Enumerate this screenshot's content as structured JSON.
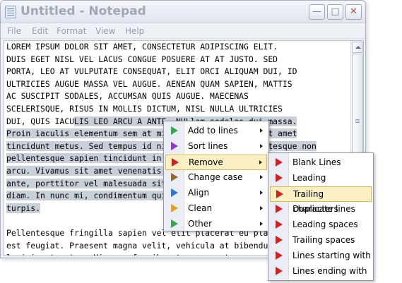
{
  "window": {
    "title": "Untitled - Notepad"
  },
  "menubar": [
    "File",
    "Edit",
    "Format",
    "View",
    "Help"
  ],
  "editor": {
    "lines": [
      {
        "pre": "LOREM IPSUM DOLOR SIT AMET, CONSECTETUR ADIPISCING ELIT.",
        "sel": "",
        "post": ""
      },
      {
        "pre": "DUIS EGET NISL VEL LACUS CONGUE POSUERE AT AT JUSTO. SED",
        "sel": "",
        "post": ""
      },
      {
        "pre": "PORTA, LEO AT VULPUTATE CONSEQUAT, ELIT ORCI ALIQUAM DUI, ID",
        "sel": "",
        "post": ""
      },
      {
        "pre": "ULTRICIES AUGUE MASSA VEL AUGUE. AENEAN QUAM SAPIEN, MATTIS",
        "sel": "",
        "post": ""
      },
      {
        "pre": "AC SUSCIPIT SODALES, ACCUMSAN QUIS AUGUE. MAECENAS",
        "sel": "",
        "post": ""
      },
      {
        "pre": "SCELERISQUE, RISUS IN MOLLIS DICTUM, NISL NULLA ULTRICIES",
        "sel": "",
        "post": ""
      },
      {
        "pre": "DUI, QUIS IACU",
        "sel": "LIS LEO ARCU A ANTE. NULlam sodales dui massa.",
        "post": ""
      },
      {
        "pre": "",
        "sel": "Proin iaculis elementum sem at mi, ut rutrum lectus sit amet",
        "post": ""
      },
      {
        "pre": "",
        "sel": "tincidunt metus. Sed tempus id nibh a fermentum pellentesque non",
        "post": ""
      },
      {
        "pre": "",
        "sel": "pellentesque sapien tincidunt in. Proin sodales ligula, id sodales",
        "post": ""
      },
      {
        "pre": "",
        "sel": "arcu. Vivamus sit amet venenatis nunc, quis tristique sed",
        "post": ""
      },
      {
        "pre": "",
        "sel": "ante, porttitor vel malesuada sit amet, ultricies sit dignissim",
        "post": ""
      },
      {
        "pre": "",
        "sel": "diam. In nunc mi, condimentum quis ullamcorper eu, placerat",
        "post": ""
      },
      {
        "pre": "",
        "sel": "turpis.",
        "post": ""
      },
      {
        "pre": "",
        "sel": "",
        "post": ""
      },
      {
        "pre": "Pellentesque fringilla sapien vel elit placerat eu placerat",
        "sel": "",
        "post": ""
      },
      {
        "pre": "est feugiat. Praesent magna velit, vehicula at bibendum a,",
        "sel": "",
        "post": ""
      },
      {
        "pre": "lacinia et metus. Vivamus faucibus tempor erat, non auctor",
        "sel": "",
        "post": ""
      }
    ]
  },
  "context_menu": {
    "items": [
      {
        "label": "Add to lines",
        "icon": "green-triangle-icon",
        "color": "#3aa64c",
        "highlighted": false
      },
      {
        "label": "Sort lines",
        "icon": "purple-triangle-icon",
        "color": "#8a3bd0",
        "highlighted": false
      },
      {
        "label": "Remove",
        "icon": "red-triangle-icon",
        "color": "#d42020",
        "highlighted": true
      },
      {
        "label": "Change case",
        "icon": "brown-triangle-icon",
        "color": "#9a6a2a",
        "highlighted": false
      },
      {
        "label": "Align",
        "icon": "blue-triangle-icon",
        "color": "#2a7ad8",
        "highlighted": false
      },
      {
        "label": "Clean",
        "icon": "gold-triangle-icon",
        "color": "#e0a020",
        "highlighted": false
      },
      {
        "label": "Other",
        "icon": "green-triangle-icon",
        "color": "#3aa64c",
        "highlighted": false
      }
    ]
  },
  "submenu": {
    "items": [
      {
        "label": "Blank Lines",
        "icon": "red-triangle-icon",
        "color": "#d42020",
        "highlighted": false
      },
      {
        "label": "Leading characters",
        "icon": "red-triangle-icon",
        "color": "#d42020",
        "highlighted": false
      },
      {
        "label": "Trailing characters",
        "icon": "red-triangle-icon",
        "color": "#d42020",
        "highlighted": true
      },
      {
        "label": "Duplicate lines",
        "icon": "red-triangle-icon",
        "color": "#d42020",
        "highlighted": false
      },
      {
        "label": "Leading spaces",
        "icon": "red-triangle-icon",
        "color": "#d42020",
        "highlighted": false
      },
      {
        "label": "Trailing spaces",
        "icon": "red-triangle-icon",
        "color": "#d42020",
        "highlighted": false
      },
      {
        "label": "Lines starting with",
        "icon": "red-triangle-icon",
        "color": "#d42020",
        "highlighted": false
      },
      {
        "label": "Lines ending with",
        "icon": "red-triangle-icon",
        "color": "#d42020",
        "highlighted": false
      }
    ]
  }
}
